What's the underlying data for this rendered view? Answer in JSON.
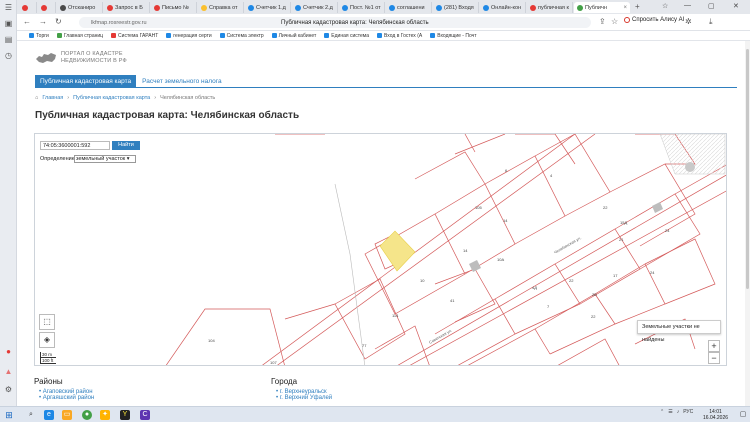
{
  "tabs": [
    {
      "label": "",
      "color": "#e53935"
    },
    {
      "label": "",
      "color": "#e53935"
    },
    {
      "label": "Отсканиро",
      "color": "#4a4a4a"
    },
    {
      "label": "Запрос в Б",
      "color": "#e53935"
    },
    {
      "label": "Письмо №",
      "color": "#e53935"
    },
    {
      "label": "Справка от",
      "color": "#fbc02d"
    },
    {
      "label": "Счетчик 1.д",
      "color": "#1e88e5"
    },
    {
      "label": "Счетчик 2.д",
      "color": "#1e88e5"
    },
    {
      "label": "Пост. №1 от",
      "color": "#1e88e5"
    },
    {
      "label": "соглашени",
      "color": "#1e88e5"
    },
    {
      "label": "(281) Входя",
      "color": "#1e88e5"
    },
    {
      "label": "Онлайн-кон",
      "color": "#1e88e5"
    },
    {
      "label": "публичная к",
      "color": "#e53935"
    },
    {
      "label": "Публичн",
      "color": "#43a047"
    }
  ],
  "address": {
    "url": "lkfmap.rosreestr.gov.ru",
    "page_title": "Публичная кадастровая карта: Челябинская область",
    "alice": "Спросить Алису AI"
  },
  "bookmarks": [
    {
      "label": "Торги",
      "color": "#1e88e5"
    },
    {
      "label": "Главная страниц",
      "color": "#43a047"
    },
    {
      "label": "Система ГАРАНТ",
      "color": "#e53935"
    },
    {
      "label": "генерация серти",
      "color": "#1e88e5"
    },
    {
      "label": "Система электр",
      "color": "#1e88e5"
    },
    {
      "label": "Личный кабинет",
      "color": "#1e88e5"
    },
    {
      "label": "Единая система",
      "color": "#1e88e5"
    },
    {
      "label": "Вход в Гостех (А",
      "color": "#1e88e5"
    },
    {
      "label": "Входящие - Почт",
      "color": "#1e88e5"
    }
  ],
  "site": {
    "logo_line1": "ПОРТАЛ О КАДАСТРЕ",
    "logo_line2": "НЕДВИЖИМОСТИ В РФ",
    "tab_active": "Публичная кадастровая карта",
    "tab_other": "Расчет земельного налога",
    "crumbs": [
      "Главная",
      "Публичная кадастровая карта",
      "Челябинская область"
    ],
    "title": "Публичная кадастровая карта: Челябинская область"
  },
  "map": {
    "search_value": "74:05:3600001:592",
    "find_label": "Найти",
    "def_label": "Определение:",
    "def_value": "земельный участок",
    "scale_m": "30 m",
    "scale_ft": "100 ft",
    "notfound": "Земельные участки не найдены",
    "zoom_in": "+",
    "zoom_out": "−",
    "highlight_color": "#f5e58a"
  },
  "regions": {
    "title": "Районы",
    "items": [
      "Агаповский район",
      "Аргаяшский район"
    ]
  },
  "cities": {
    "title": "Города",
    "items": [
      "г. Верхнеуральск",
      "г. Верхний Уфалей"
    ]
  },
  "taskbar": {
    "lang": "РУС",
    "time": "14:01",
    "date": "16.04.2026"
  }
}
